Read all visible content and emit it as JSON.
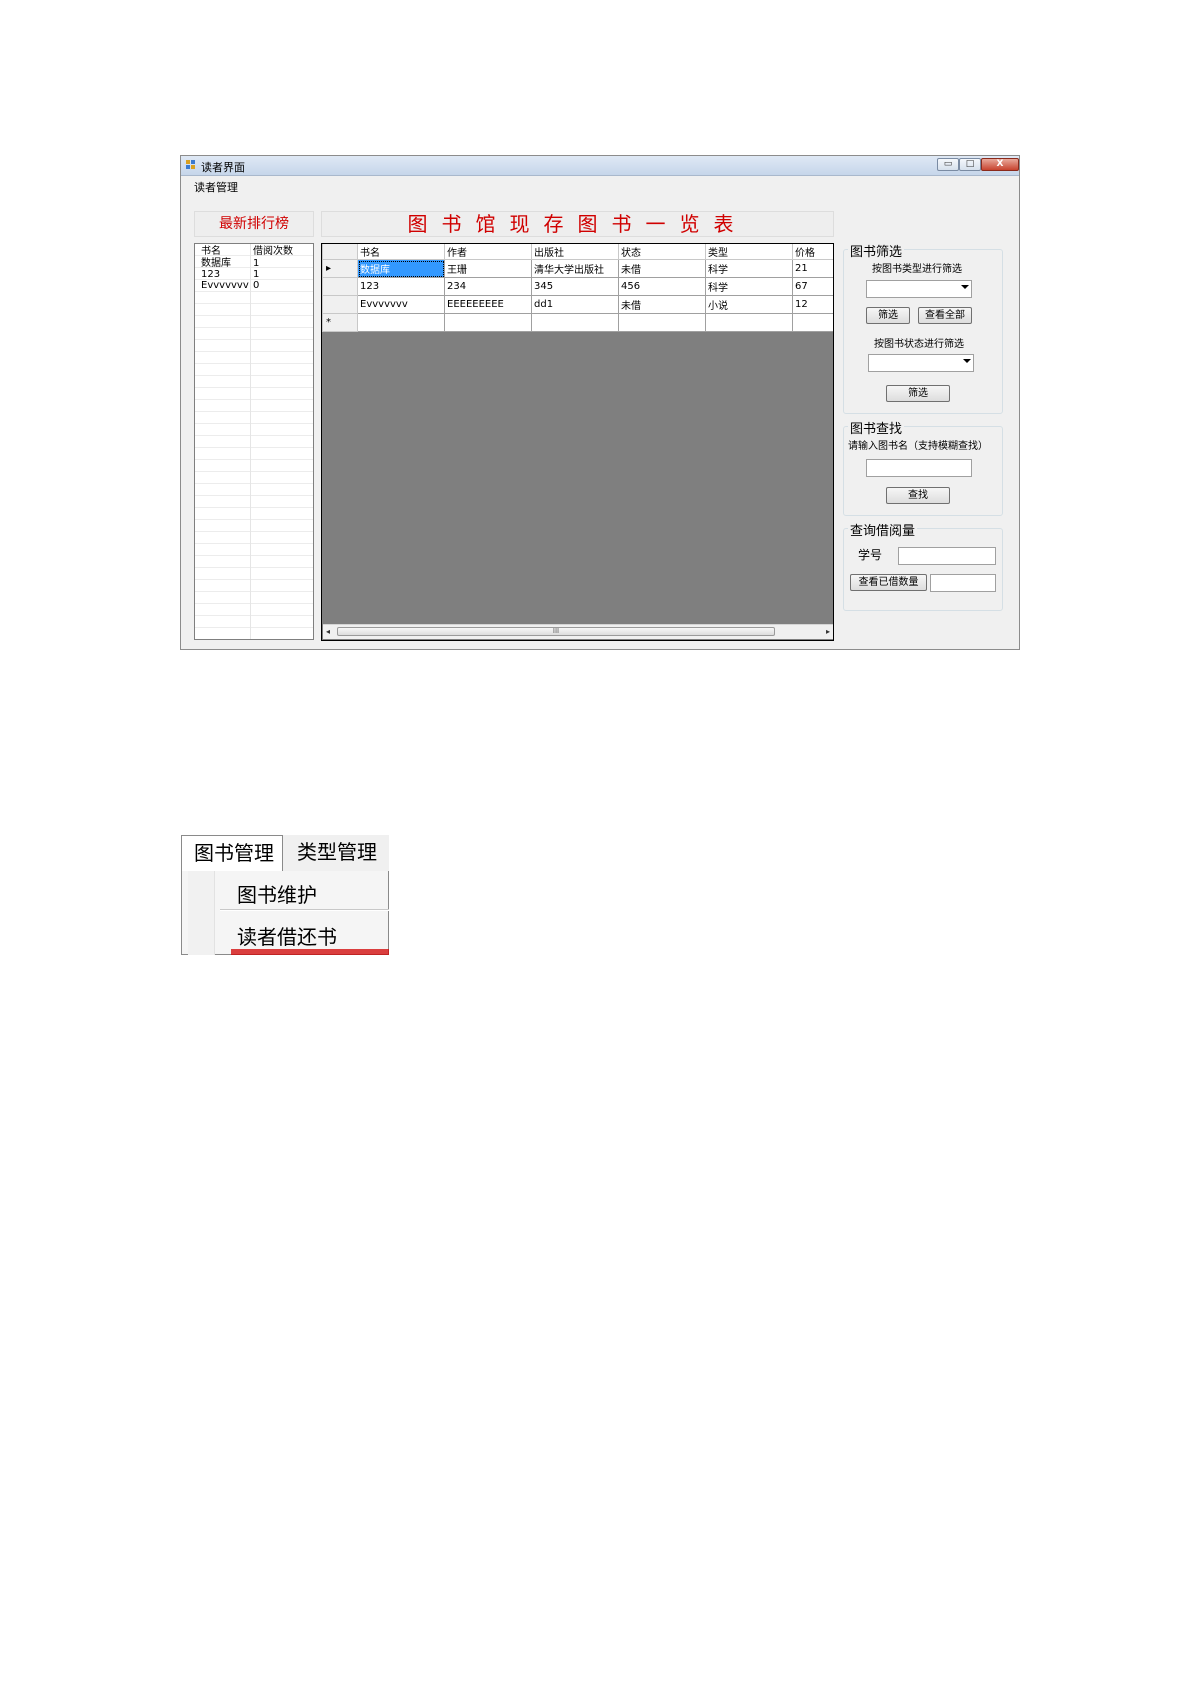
{
  "window": {
    "title": "读者界面",
    "min_label": "▭",
    "max_label": "□",
    "close_label": "X"
  },
  "menubar": {
    "item": "读者管理"
  },
  "rank": {
    "title": "最新排行榜",
    "headers": [
      "书名",
      "借阅次数"
    ],
    "rows": [
      [
        "数据库",
        "1"
      ],
      [
        "123",
        "1"
      ],
      [
        "Evvvvvvv",
        "0"
      ]
    ]
  },
  "main_title": "图书馆现存图书一览表",
  "book_table": {
    "headers": [
      "书名",
      "作者",
      "出版社",
      "状态",
      "类型",
      "价格"
    ],
    "rows": [
      {
        "indicator": "▸",
        "cells": [
          "数据库",
          "王珊",
          "清华大学出版社",
          "未借",
          "科学",
          "21"
        ]
      },
      {
        "indicator": "",
        "cells": [
          "123",
          "234",
          "345",
          "456",
          "科学",
          "67"
        ]
      },
      {
        "indicator": "",
        "cells": [
          "Evvvvvvv",
          "EEEEEEEEE",
          "dd1",
          "未借",
          "小说",
          "12"
        ]
      },
      {
        "indicator": "*",
        "cells": [
          "",
          "",
          "",
          "",
          "",
          ""
        ]
      }
    ],
    "scroll_grip": "III",
    "scroll_left": "◂",
    "scroll_right": "▸"
  },
  "filter": {
    "title": "图书筛选",
    "type_label": "按图书类型进行筛选",
    "filter_btn": "筛选",
    "view_all_btn": "查看全部",
    "status_label": "按图书状态进行筛选",
    "filter_btn2": "筛选"
  },
  "search": {
    "title": "图书查找",
    "prompt": "请输入图书名（支持模糊查找）",
    "search_btn": "查找"
  },
  "borrow": {
    "title": "查询借阅量",
    "student_id_label": "学号",
    "check_btn": "查看已借数量"
  },
  "menu_shot": {
    "tabs": [
      "图书管理",
      "类型管理"
    ],
    "items": [
      "图书维护",
      "读者借还书"
    ]
  },
  "colors": {
    "title_red": "#d00000",
    "selection": "#3399ff",
    "grid_bg": "#7f7f7f"
  }
}
